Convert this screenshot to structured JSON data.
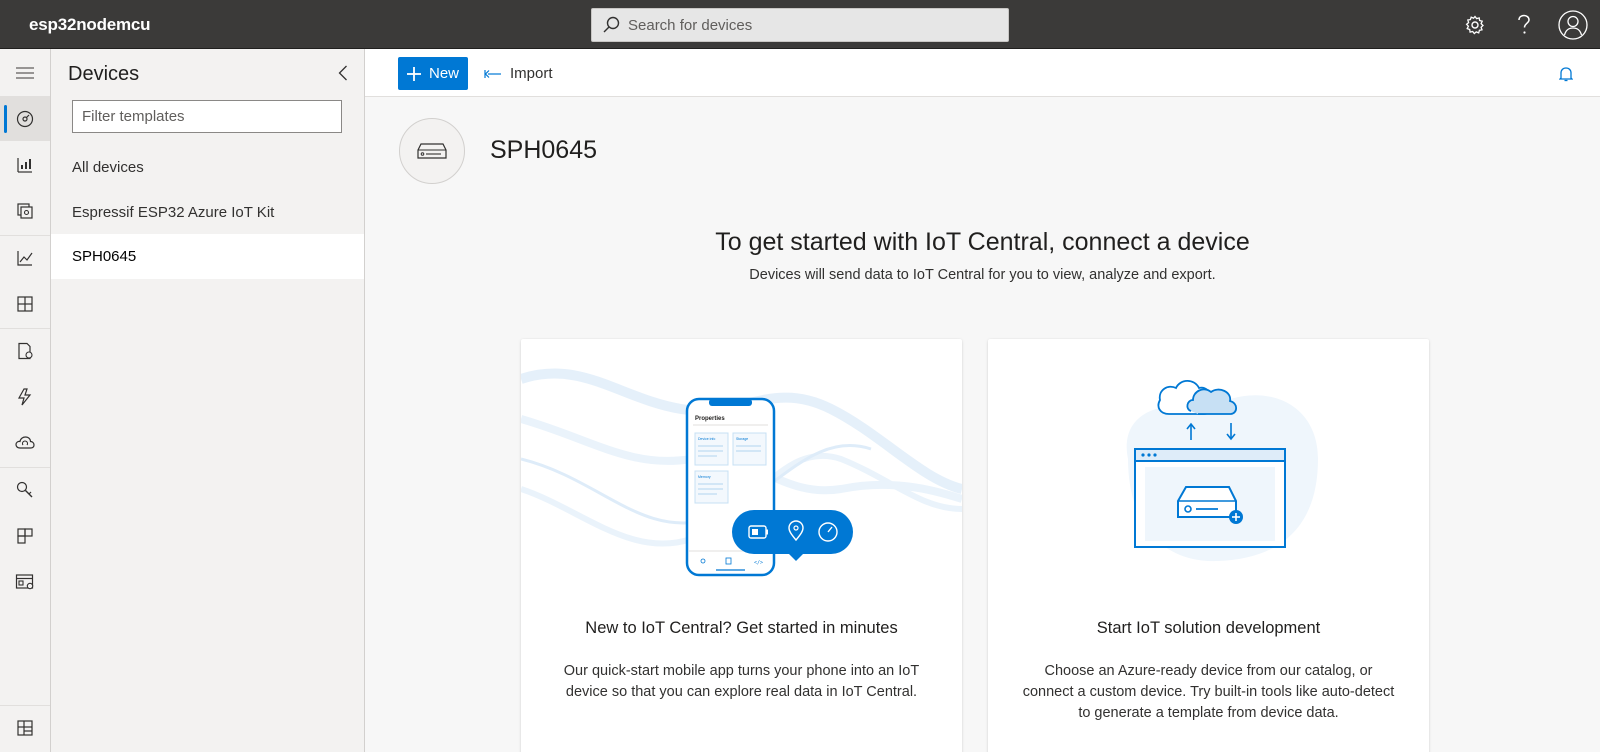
{
  "app": {
    "name": "esp32nodemcu"
  },
  "search": {
    "placeholder": "Search for devices"
  },
  "topbar_icons": [
    "gear-icon",
    "help-icon",
    "account-icon"
  ],
  "rail": {
    "items": [
      "menu-icon",
      "dashboard-icon",
      "devices-icon",
      "device-groups-icon",
      "analytics-icon",
      "device-templates-icon",
      "data-export-icon",
      "rules-icon",
      "jobs-icon",
      "settings-icon",
      "customization-icon",
      "administration-icon",
      "bottom-tile-icon"
    ],
    "active": "dashboard-icon"
  },
  "panel": {
    "title": "Devices",
    "filter_placeholder": "Filter templates",
    "items": [
      "All devices",
      "Espressif ESP32 Azure IoT Kit",
      "SPH0645"
    ],
    "selected": "SPH0645"
  },
  "commands": {
    "new_label": "New",
    "import_label": "Import"
  },
  "template": {
    "name": "SPH0645"
  },
  "hero": {
    "title": "To get started with IoT Central, connect a device",
    "subtitle": "Devices will send data to IoT Central for you to view, analyze and export."
  },
  "cards": [
    {
      "title": "New to IoT Central? Get started in minutes",
      "description": "Our quick-start mobile app turns your phone into an IoT device so that you can explore real data in IoT Central.",
      "illustration": {
        "screen_title": "Properties",
        "tiles": [
          "Device info",
          "Storage",
          "Memory"
        ]
      }
    },
    {
      "title": "Start IoT solution development",
      "description": "Choose an Azure-ready device from our catalog, or connect a custom device. Try built-in tools like auto-detect to generate a template from device data."
    }
  ],
  "colors": {
    "accent": "#0078d4",
    "topbar": "#3b3a39",
    "rail": "#f3f2f1",
    "canvas": "#f7f7f7"
  }
}
